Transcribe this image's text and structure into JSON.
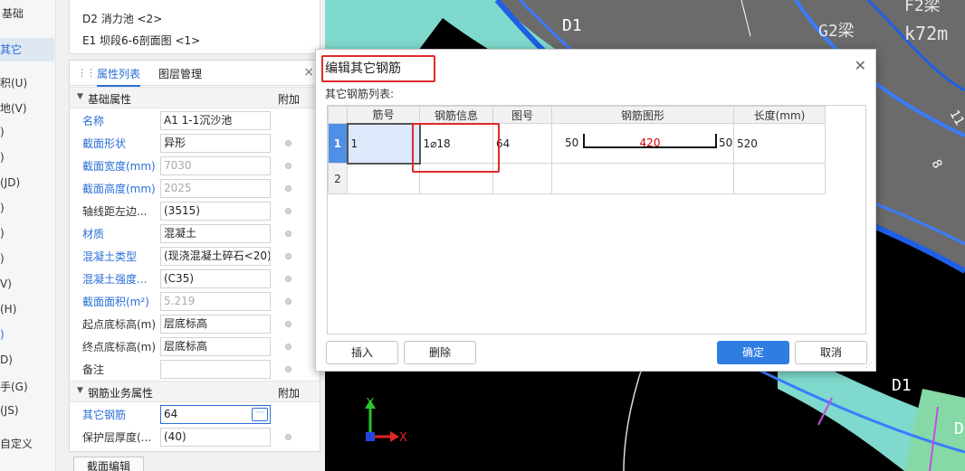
{
  "left_nav": {
    "items": [
      "基础",
      "其它",
      "积(U)",
      "地(V)",
      ")",
      ")",
      "(JD)",
      ")",
      ")",
      ")",
      "V)",
      "(H)",
      ")",
      "D)",
      "手(G)",
      "(JS)",
      "自定义"
    ],
    "active_index": 1
  },
  "tree": {
    "items": [
      "D2 消力池 <2>",
      "E1 坝段6-6剖面图 <1>"
    ]
  },
  "properties": {
    "tabs": [
      "属性列表",
      "图层管理"
    ],
    "group1": {
      "label": "基础属性",
      "extra": "附加"
    },
    "rows": [
      {
        "label": "名称",
        "value": "A1  1-1沉沙池",
        "blue": true,
        "dot": false,
        "gray": false
      },
      {
        "label": "截面形状",
        "value": "异形",
        "blue": true,
        "dot": true,
        "gray": false
      },
      {
        "label": "截面宽度(mm)",
        "value": "7030",
        "blue": true,
        "dot": true,
        "gray": true
      },
      {
        "label": "截面高度(mm)",
        "value": "2025",
        "blue": true,
        "dot": true,
        "gray": true
      },
      {
        "label": "轴线距左边...",
        "value": "(3515)",
        "blue": false,
        "dot": true,
        "gray": false
      },
      {
        "label": "材质",
        "value": "混凝土",
        "blue": true,
        "dot": true,
        "gray": false
      },
      {
        "label": "混凝土类型",
        "value": "(现浇混凝土碎石<20)",
        "blue": true,
        "dot": true,
        "gray": false
      },
      {
        "label": "混凝土强度...",
        "value": "(C35)",
        "blue": true,
        "dot": true,
        "gray": false
      },
      {
        "label": "截面面积(m²)",
        "value": "5.219",
        "blue": true,
        "dot": true,
        "gray": true
      },
      {
        "label": "起点底标高(m)",
        "value": "层底标高",
        "blue": false,
        "dot": true,
        "gray": false
      },
      {
        "label": "终点底标高(m)",
        "value": "层底标高",
        "blue": false,
        "dot": true,
        "gray": false
      },
      {
        "label": "备注",
        "value": "",
        "blue": false,
        "dot": true,
        "gray": false
      }
    ],
    "group2": {
      "label": "钢筋业务属性",
      "extra": "附加"
    },
    "rows2": [
      {
        "label": "其它钢筋",
        "value": "64",
        "blue": true
      },
      {
        "label": "保护层厚度(...",
        "value": "(40)",
        "blue": false
      }
    ],
    "bottom_button": "截面编辑"
  },
  "viewport": {
    "labels": [
      "D1",
      "G2梁",
      "F2梁",
      "k72m",
      "D1",
      "D",
      "11",
      "8"
    ],
    "axis_y": "Y",
    "axis_x": "X"
  },
  "dialog": {
    "title": "编辑其它钢筋",
    "subtitle": "其它钢筋列表:",
    "columns": [
      "筋号",
      "钢筋信息",
      "图号",
      "钢筋图形",
      "长度(mm)"
    ],
    "rows": [
      {
        "num": "1",
        "bar_no": "1",
        "info": "1⌀18",
        "fig": "64",
        "shape_left": "50",
        "shape_mid": "420",
        "shape_right": "50",
        "length": "520"
      },
      {
        "num": "2",
        "bar_no": "",
        "info": "",
        "fig": "",
        "shape_left": "",
        "shape_mid": "",
        "shape_right": "",
        "length": ""
      }
    ],
    "buttons": {
      "insert": "插入",
      "delete": "删除",
      "ok": "确定",
      "cancel": "取消"
    }
  }
}
